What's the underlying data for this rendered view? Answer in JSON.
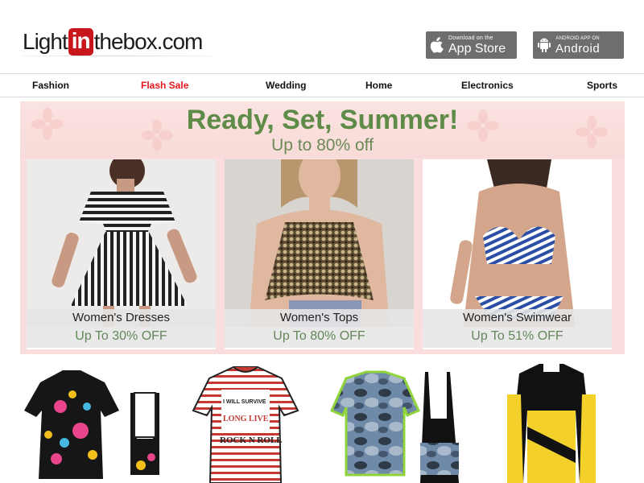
{
  "header": {
    "logo": {
      "part1": "Light",
      "part2": "in",
      "part3": "thebox.com"
    },
    "appstore": {
      "small": "Download on the",
      "big": "App Store"
    },
    "android": {
      "small": "ANDROID APP ON",
      "big": "Android"
    }
  },
  "nav": {
    "items": [
      "Fashion",
      "Flash Sale",
      "Wedding",
      "Home",
      "Electronics",
      "Sports"
    ]
  },
  "banner": {
    "title": "Ready, Set, Summer!",
    "subtitle": "Up to 80% off",
    "cards": [
      {
        "name": "Women's Dresses",
        "offer": "Up To 30% OFF"
      },
      {
        "name": "Women's Tops",
        "offer": "Up To 80% OFF"
      },
      {
        "name": "Women's Swimwear",
        "offer": "Up To 51% OFF"
      }
    ]
  },
  "products": [
    {
      "icon": "cycling-jersey-butterfly-image"
    },
    {
      "icon": "cycling-jersey-rock-n-roll-image",
      "print_top": "I WILL SURVIVE",
      "print_mid": "LONG LIVE",
      "print_bottom": "ROCK N ROLL"
    },
    {
      "icon": "cycling-jersey-camo-image"
    },
    {
      "icon": "cycling-jersey-yellow-image"
    }
  ],
  "colors": {
    "sale_red": "#e8141c",
    "logo_red": "#c8161d",
    "banner_green": "#5e8b48",
    "store_gray": "#6e6e6e"
  }
}
